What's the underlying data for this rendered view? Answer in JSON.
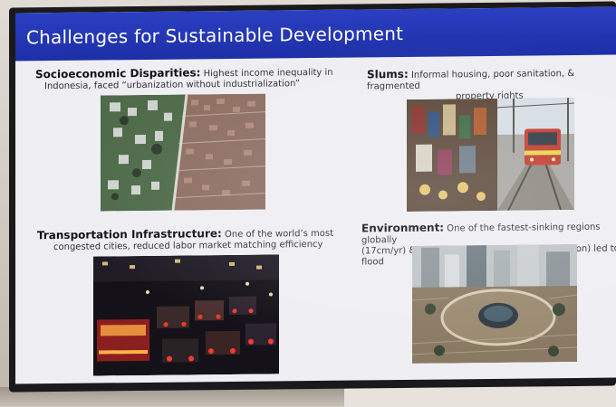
{
  "slide": {
    "title": "Challenges for Sustainable Development",
    "sections": {
      "socio": {
        "heading": "Socioeconomic Disparities:",
        "text_1": "Highest income inequality in",
        "text_2": "Indonesia, faced “urbanization without industrialization”"
      },
      "slums": {
        "heading": "Slums:",
        "text_1": "Informal housing, poor sanitation, & fragmented",
        "text_2": "property rights"
      },
      "transport": {
        "heading": "Transportation Infrastructure:",
        "text_1": "One of the world’s most",
        "text_2": "congested cities, reduced labor market matching efficiency"
      },
      "environment": {
        "heading": "Environment:",
        "text_1": "One of the fastest-sinking regions globally",
        "text_2": "(17cm/yr) & poor drainage (10% water infiltration) led to flood"
      }
    }
  }
}
